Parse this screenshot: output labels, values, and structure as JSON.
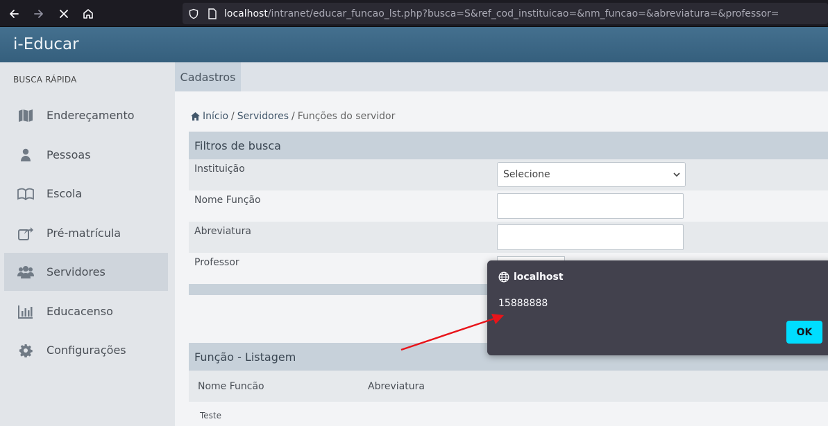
{
  "browser": {
    "url_host": "localhost",
    "url_rest": "/intranet/educar_funcao_lst.php?busca=S&ref_cod_instituicao=&nm_funcao=&abreviatura=&professor="
  },
  "app": {
    "title": "i-Educar"
  },
  "sidebar": {
    "heading": "BUSCA RÁPIDA",
    "items": [
      {
        "label": "Endereçamento",
        "icon": "map-icon"
      },
      {
        "label": "Pessoas",
        "icon": "user-icon"
      },
      {
        "label": "Escola",
        "icon": "book-icon"
      },
      {
        "label": "Pré-matrícula",
        "icon": "share-icon"
      },
      {
        "label": "Servidores",
        "icon": "users-icon",
        "active": true
      },
      {
        "label": "Educacenso",
        "icon": "bar-chart-icon"
      },
      {
        "label": "Configurações",
        "icon": "gear-icon"
      }
    ]
  },
  "tabs": {
    "cadastros": "Cadastros"
  },
  "breadcrumb": {
    "home": "Início",
    "sep1": "/",
    "servidores": "Servidores",
    "sep2": "/",
    "current": "Funções do servidor"
  },
  "filters": {
    "title": "Filtros de busca",
    "instituicao_label": "Instituição",
    "instituicao_value": "Selecione",
    "nome_label": "Nome Função",
    "abreviatura_label": "Abreviatura",
    "professor_label": "Professor"
  },
  "listing": {
    "title": "Função - Listagem",
    "columns": [
      "Nome Funcão",
      "Abreviatura"
    ],
    "rows": [
      {
        "nome": "Teste",
        "abreviatura": ""
      }
    ]
  },
  "dialog": {
    "title": "localhost",
    "message": "15888888",
    "ok_label": "OK"
  },
  "colors": {
    "header": "#3c6e8f",
    "dialog_bg": "#42414d",
    "ok_button": "#00ddff",
    "annotation_arrow": "#e8141a"
  }
}
